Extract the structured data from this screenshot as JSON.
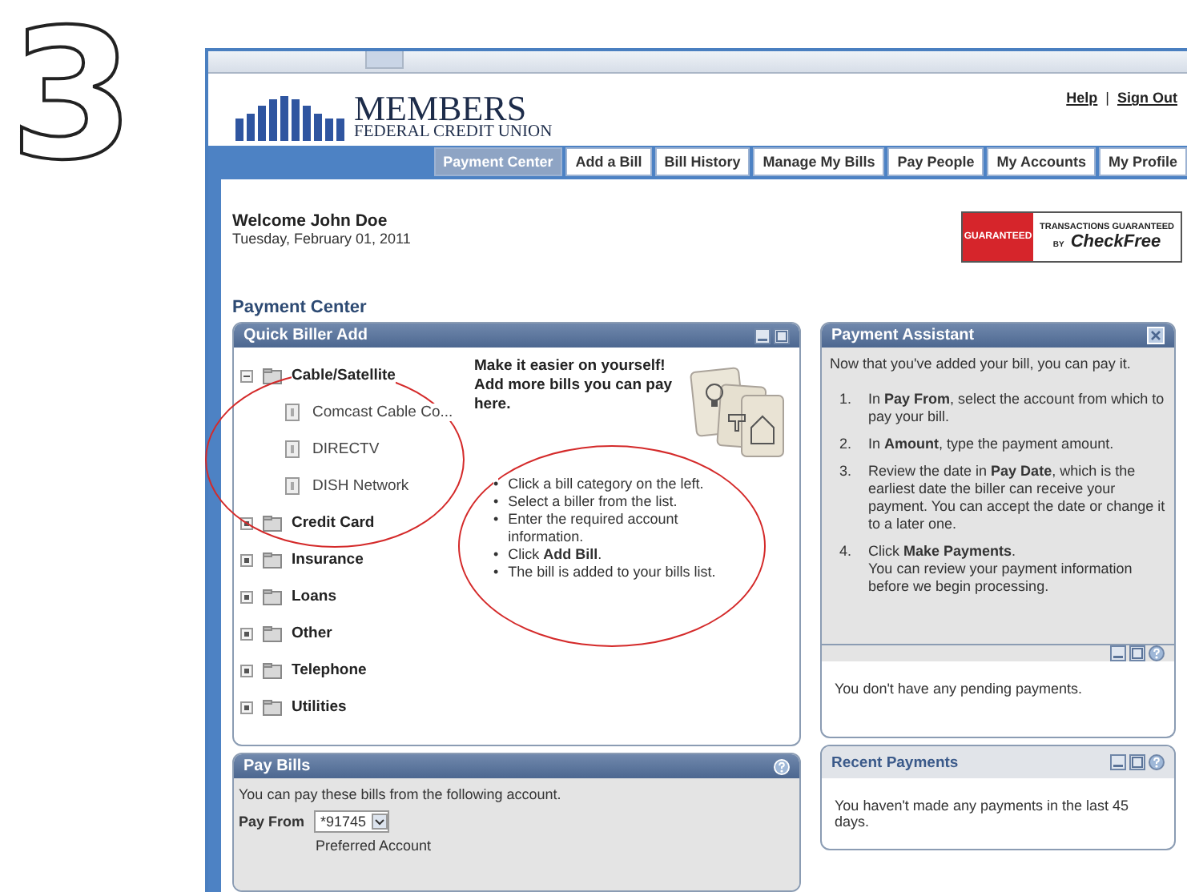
{
  "step_number": "3",
  "header": {
    "logo_name": "MEMBERS",
    "logo_subtitle": "FEDERAL CREDIT UNION",
    "links": [
      "Help",
      "Sign Out"
    ],
    "link_separator": "|"
  },
  "nav_tabs": [
    {
      "label": "Payment Center",
      "selected": true
    },
    {
      "label": "Add a Bill",
      "selected": false
    },
    {
      "label": "Bill History",
      "selected": false
    },
    {
      "label": "Manage My Bills",
      "selected": false
    },
    {
      "label": "Pay People",
      "selected": false
    },
    {
      "label": "My Accounts",
      "selected": false
    },
    {
      "label": "My Profile",
      "selected": false
    }
  ],
  "welcome": {
    "greeting": "Welcome John Doe",
    "date": "Tuesday, February 01, 2011"
  },
  "badge": {
    "seal": "GUARANTEED",
    "headline": "TRANSACTIONS GUARANTEED",
    "by": "BY",
    "brand": "CheckFree"
  },
  "page_title": "Payment Center",
  "quick_biller_add": {
    "title": "Quick Biller Add",
    "categories": [
      {
        "label": "Cable/Satellite",
        "expanded": true,
        "children": [
          {
            "label": "Comcast Cable Co..."
          },
          {
            "label": "DIRECTV"
          },
          {
            "label": "DISH Network"
          }
        ]
      },
      {
        "label": "Credit Card",
        "expanded": false
      },
      {
        "label": "Insurance",
        "expanded": false
      },
      {
        "label": "Loans",
        "expanded": false
      },
      {
        "label": "Other",
        "expanded": false
      },
      {
        "label": "Telephone",
        "expanded": false
      },
      {
        "label": "Utilities",
        "expanded": false
      }
    ],
    "intro": "Make it easier on yourself! Add more bills you can pay here.",
    "list_marker": "•",
    "steps": [
      "Click a bill category on the left.",
      "Select a biller from the list.",
      "Enter the required account information.",
      "Click **Add Bill**.",
      "The bill is added to your bills list."
    ]
  },
  "payment_assistant": {
    "title": "Payment Assistant",
    "intro": "Now that you've added your bill, you can pay it.",
    "steps": [
      {
        "number": "1.",
        "text": "In **Pay From**, select the account from which to pay your bill."
      },
      {
        "number": "2.",
        "text": "In **Amount**, type the payment amount."
      },
      {
        "number": "3.",
        "text": "Review the date in **Pay Date**, which is the earliest date the biller can receive your payment. You can accept the date or change it to a later one."
      },
      {
        "number": "4.",
        "text": "Click **Make Payments**.",
        "note": "You can review your payment information before we begin processing."
      }
    ]
  },
  "pending_payments": {
    "message": "You don't have any pending payments."
  },
  "pay_bills": {
    "title": "Pay Bills",
    "intro": "You can pay these bills from the following account.",
    "pay_from_label": "Pay From",
    "account": "*91745",
    "account_note": "Preferred Account"
  },
  "recent_payments": {
    "title": "Recent Payments",
    "message": "You haven't made any payments in the last 45 days."
  }
}
